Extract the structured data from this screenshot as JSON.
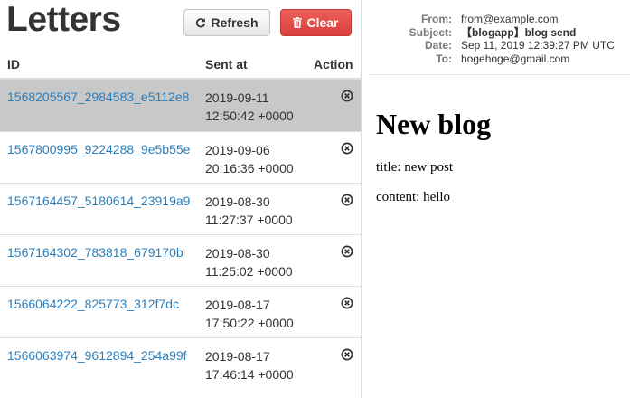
{
  "list": {
    "title": "Letters",
    "refresh_label": "Refresh",
    "clear_label": "Clear",
    "columns": {
      "id": "ID",
      "sent_at": "Sent at",
      "action": "Action"
    },
    "rows": [
      {
        "id": "1568205567_2984583_e5112e8",
        "date": "2019-09-11",
        "time": "12:50:42 +0000",
        "selected": true
      },
      {
        "id": "1567800995_9224288_9e5b55e",
        "date": "2019-09-06",
        "time": "20:16:36 +0000",
        "selected": false
      },
      {
        "id": "1567164457_5180614_23919a9",
        "date": "2019-08-30",
        "time": "11:27:37 +0000",
        "selected": false
      },
      {
        "id": "1567164302_783818_679170b",
        "date": "2019-08-30",
        "time": "11:25:02 +0000",
        "selected": false
      },
      {
        "id": "1566064222_825773_312f7dc",
        "date": "2019-08-17",
        "time": "17:50:22 +0000",
        "selected": false
      },
      {
        "id": "1566063974_9612894_254a99f",
        "date": "2019-08-17",
        "time": "17:46:14 +0000",
        "selected": false
      }
    ],
    "icons": {
      "refresh": "refresh-icon",
      "clear": "trash-icon",
      "delete": "circle-x-icon"
    },
    "colors": {
      "link": "#2a7fbd",
      "danger": "#d9403c",
      "selected_row": "#c8c8c8"
    }
  },
  "message": {
    "labels": {
      "from": "From:",
      "subject": "Subject:",
      "date": "Date:",
      "to": "To:"
    },
    "from": "from@example.com",
    "subject": "【blogapp】blog send",
    "date": "Sep 11, 2019 12:39:27 PM UTC",
    "to": "hogehoge@gmail.com",
    "body": {
      "heading": "New blog",
      "lines": [
        "title: new post",
        "content: hello"
      ]
    }
  }
}
